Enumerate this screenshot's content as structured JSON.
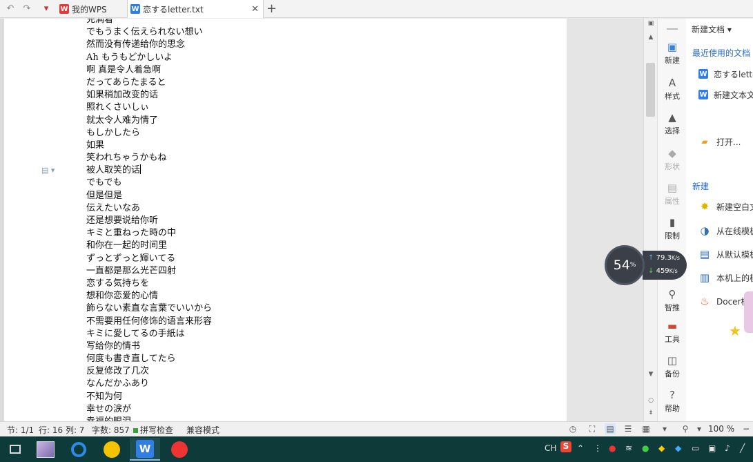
{
  "tabs": {
    "home_label": "我的WPS",
    "doc_label": "恋するletter.txt"
  },
  "document": {
    "lines": [
      "充满着",
      "でもうまく伝えられない想い",
      "然而没有传递给你的思念",
      "Ah もうもどかしいよ",
      "啊 真是令人着急啊",
      "だってあらたまると",
      "如果稍加改变的话",
      "照れくさいしぃ",
      "就太令人难为情了",
      "もしかしたら",
      "如果",
      "笑われちゃうかもね",
      "被人取笑的话",
      "でもでも",
      "但是但是",
      "伝えたいなあ",
      "还是想要说给你听",
      "キミと重ねった時の中",
      "和你在一起的时间里",
      "ずっとずっと輝いてる",
      "一直都是那么光芒四射",
      "恋する気持ちを",
      "想和你恋爱的心情",
      "飾らない素直な言葉でいいから",
      "不需要用任何修饰的语言来形容",
      "キミに愛してるの手紙は",
      "写给你的情书",
      "何度も書き直してたら",
      "反复修改了几次",
      "なんだかふあり",
      "不知为何",
      "幸せの涙が",
      "幸福的眼泪"
    ]
  },
  "sidebar_icons": [
    {
      "label": "新建",
      "icon": "new-doc-icon"
    },
    {
      "label": "样式",
      "icon": "style-icon"
    },
    {
      "label": "选择",
      "icon": "select-icon"
    },
    {
      "label": "形状",
      "icon": "shape-icon"
    },
    {
      "label": "属性",
      "icon": "property-icon"
    },
    {
      "label": "限制",
      "icon": "restrict-icon"
    },
    {
      "label": "智推",
      "icon": "smart-push-icon"
    },
    {
      "label": "工具",
      "icon": "tools-icon"
    },
    {
      "label": "备份",
      "icon": "backup-icon"
    },
    {
      "label": "帮助",
      "icon": "help-icon"
    }
  ],
  "panel": {
    "header": "新建文档 ▾",
    "recent_title": "最近使用的文档",
    "recent_items": [
      "恋するletter.txt",
      "新建文本文档"
    ],
    "open_label": "打开...",
    "new_title": "新建",
    "new_items": [
      "新建空白文档",
      "从在线模板新建",
      "从默认模板新建",
      "本机上的模板",
      "Docer模板"
    ]
  },
  "status": {
    "section": "节: 1/1",
    "row_col": "行: 16  列: 7",
    "word_count": "字数: 857",
    "spellcheck": "拼写检查",
    "compat": "兼容模式",
    "zoom": "100 %"
  },
  "netmon": {
    "percent": "54",
    "percent_unit": "%",
    "up": "79.3",
    "down": "459",
    "unit": "K/s"
  },
  "tray": {
    "lang": "CH",
    "ime": "S"
  }
}
